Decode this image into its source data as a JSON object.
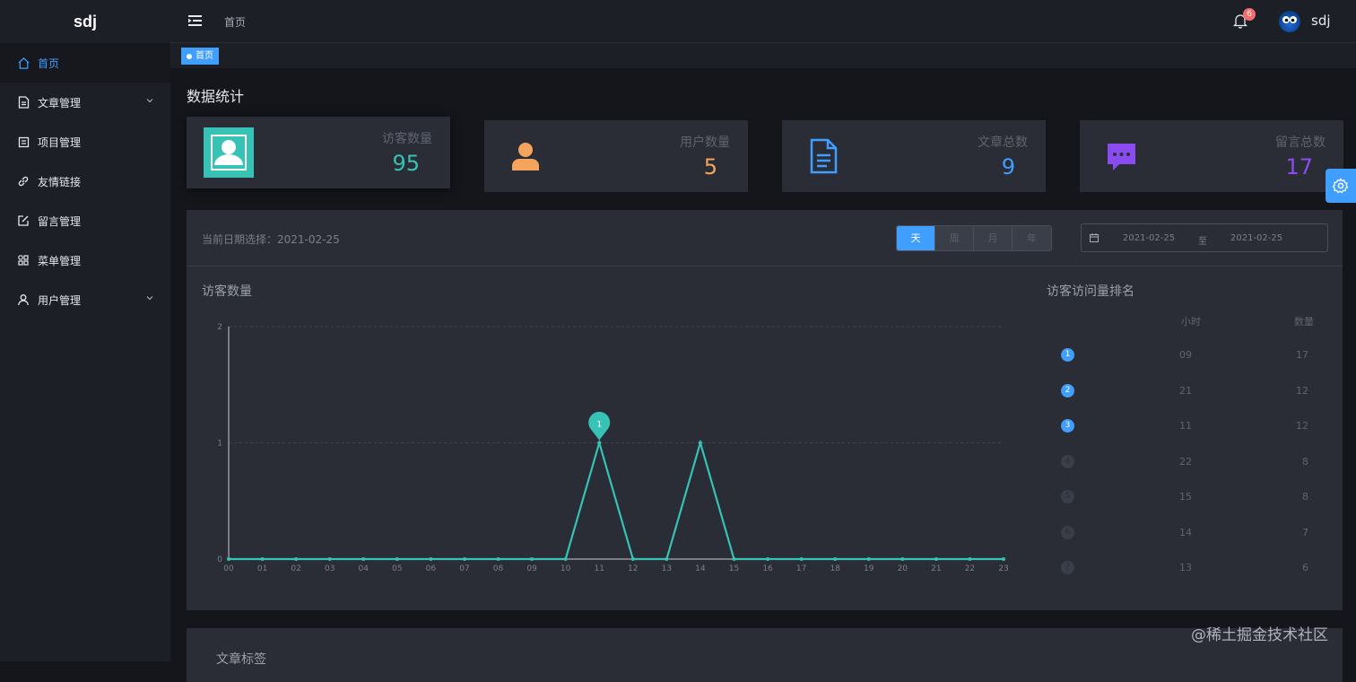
{
  "app": {
    "logo": "sdj"
  },
  "sidebar": {
    "items": [
      {
        "label": "首页",
        "icon": "home-icon",
        "active": true,
        "expandable": false
      },
      {
        "label": "文章管理",
        "icon": "document-icon",
        "active": false,
        "expandable": true
      },
      {
        "label": "项目管理",
        "icon": "list-icon",
        "active": false,
        "expandable": false
      },
      {
        "label": "友情链接",
        "icon": "link-icon",
        "active": false,
        "expandable": false
      },
      {
        "label": "留言管理",
        "icon": "edit-icon",
        "active": false,
        "expandable": false
      },
      {
        "label": "菜单管理",
        "icon": "grid-icon",
        "active": false,
        "expandable": false
      },
      {
        "label": "用户管理",
        "icon": "user-icon",
        "active": false,
        "expandable": true
      }
    ]
  },
  "header": {
    "breadcrumb": "首页",
    "notification_count": "6",
    "username": "sdj"
  },
  "tags": {
    "current": "首页"
  },
  "dashboard": {
    "title": "数据统计",
    "stats": [
      {
        "label": "访客数量",
        "value": "95",
        "color": "#36c2b4",
        "icon": "visitor-icon"
      },
      {
        "label": "用户数量",
        "value": "5",
        "color": "#f4a45d",
        "icon": "user-icon"
      },
      {
        "label": "文章总数",
        "value": "9",
        "color": "#409eff",
        "icon": "article-icon"
      },
      {
        "label": "留言总数",
        "value": "17",
        "color": "#8a4cf0",
        "icon": "message-icon"
      }
    ]
  },
  "filter": {
    "date_label": "当前日期选择：",
    "date_value": "2021-02-25",
    "periods": [
      "天",
      "周",
      "月",
      "年"
    ],
    "active_period": "天",
    "range_start": "2021-02-25",
    "range_sep": "至",
    "range_end": "2021-02-25"
  },
  "chart_title": "访客数量",
  "chart_data": {
    "type": "line",
    "x": [
      "00",
      "01",
      "02",
      "03",
      "04",
      "05",
      "06",
      "07",
      "08",
      "09",
      "10",
      "11",
      "12",
      "13",
      "14",
      "15",
      "16",
      "17",
      "18",
      "19",
      "20",
      "21",
      "22",
      "23"
    ],
    "values": [
      0,
      0,
      0,
      0,
      0,
      0,
      0,
      0,
      0,
      0,
      0,
      1,
      0,
      0,
      1,
      0,
      0,
      0,
      0,
      0,
      0,
      0,
      0,
      0
    ],
    "ylim": [
      0,
      2
    ],
    "yticks": [
      "0",
      "1",
      "2"
    ],
    "markpoint": {
      "x": "11",
      "label": "1"
    },
    "color": "#36c2b4",
    "grid": true
  },
  "ranking": {
    "title": "访客访问量排名",
    "col_hour": "小时",
    "col_count": "数量",
    "rows": [
      {
        "rank": "1",
        "hour": "09",
        "count": "17"
      },
      {
        "rank": "2",
        "hour": "21",
        "count": "12"
      },
      {
        "rank": "3",
        "hour": "11",
        "count": "12"
      },
      {
        "rank": "4",
        "hour": "22",
        "count": "8"
      },
      {
        "rank": "5",
        "hour": "15",
        "count": "8"
      },
      {
        "rank": "6",
        "hour": "14",
        "count": "7"
      },
      {
        "rank": "7",
        "hour": "13",
        "count": "6"
      }
    ]
  },
  "tags_panel_title": "文章标签",
  "watermark": "@稀土掘金技术社区"
}
